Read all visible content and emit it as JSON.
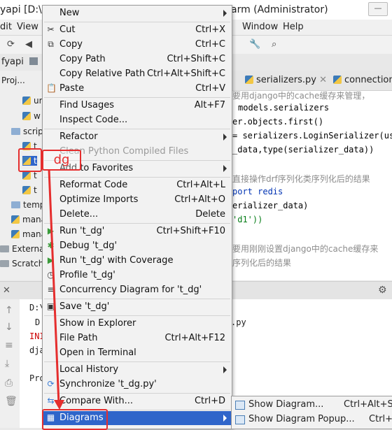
{
  "window": {
    "title_left": "yapi [D:\\Vir",
    "title_right": "arm (Administrator)",
    "controls": [
      "—",
      "□",
      "✕"
    ]
  },
  "menubar": {
    "left_items": [
      "dit",
      "View"
    ],
    "right_items": [
      "Window",
      "Help"
    ]
  },
  "navbar": {
    "project_name": "fyapi",
    "panel_label": "Proj..."
  },
  "project_tree": [
    {
      "label": "ur",
      "type": "py"
    },
    {
      "label": "w",
      "type": "py"
    },
    {
      "label": "scrip",
      "type": "folder"
    },
    {
      "label": "t",
      "type": "py"
    },
    {
      "label": "t",
      "type": "py"
    },
    {
      "label": "t",
      "type": "py"
    },
    {
      "label": "t",
      "type": "py"
    },
    {
      "label": "temp",
      "type": "folder"
    },
    {
      "label": "mana",
      "type": "py"
    },
    {
      "label": "mana",
      "type": "py"
    },
    {
      "label": "External",
      "type": "lib"
    },
    {
      "label": "Scratche",
      "type": "scratch"
    }
  ],
  "editor": {
    "tabs": [
      "serializers.py",
      "connection"
    ],
    "lines": [
      {
        "text": "要用django中的cache缓存来管理，",
        "kind": "comment"
      },
      {
        "text": "models.serializers",
        "kind": "code"
      },
      {
        "text": "er.objects.first()",
        "kind": "code"
      },
      {
        "text": "= serializers.LoginSerializer(use",
        "kind": "code"
      },
      {
        "text": "_data,type(serializer_data))",
        "kind": "code"
      },
      {
        "text": "直接操作drf序列化类序列化后的结果",
        "kind": "comment"
      },
      {
        "text": "port redis",
        "kind": "kw"
      },
      {
        "text": "erializer_data)",
        "kind": "code"
      },
      {
        "text": "'d1'))",
        "kind": "str"
      },
      {
        "text": "要用刚刚设置django中的cache缓存来",
        "kind": "comment"
      },
      {
        "text": "序列化后的结果",
        "kind": "comment"
      }
    ]
  },
  "run_output": {
    "lines": [
      "D:\\",
      "D",
      "INI",
      "dja",
      "Pro"
    ],
    "trailing": ".py"
  },
  "context_menu": {
    "items": [
      {
        "label": "New",
        "shortcut": "",
        "submenu": true,
        "icon": ""
      },
      {
        "sep": true
      },
      {
        "label": "Cut",
        "shortcut": "Ctrl+X",
        "icon": "scissors-icon"
      },
      {
        "label": "Copy",
        "shortcut": "Ctrl+C",
        "icon": "copy-icon"
      },
      {
        "label": "Copy Path",
        "shortcut": "Ctrl+Shift+C",
        "icon": ""
      },
      {
        "label": "Copy Relative Path",
        "shortcut": "Ctrl+Alt+Shift+C",
        "icon": ""
      },
      {
        "label": "Paste",
        "shortcut": "Ctrl+V",
        "icon": "paste-icon"
      },
      {
        "sep": true
      },
      {
        "label": "Find Usages",
        "shortcut": "Alt+F7",
        "icon": ""
      },
      {
        "label": "Inspect Code...",
        "shortcut": "",
        "icon": ""
      },
      {
        "sep": true
      },
      {
        "label": "Refactor",
        "shortcut": "",
        "submenu": true,
        "icon": ""
      },
      {
        "label": "Clean Python Compiled Files",
        "shortcut": "",
        "disabled": true,
        "icon": ""
      },
      {
        "sep": true
      },
      {
        "label": "Add to Favorites",
        "shortcut": "",
        "submenu": true,
        "icon": ""
      },
      {
        "sep": true
      },
      {
        "label": "Reformat Code",
        "shortcut": "Ctrl+Alt+L",
        "icon": ""
      },
      {
        "label": "Optimize Imports",
        "shortcut": "Ctrl+Alt+O",
        "icon": ""
      },
      {
        "label": "Delete...",
        "shortcut": "Delete",
        "icon": ""
      },
      {
        "sep": true
      },
      {
        "label": "Run 't_dg'",
        "shortcut": "Ctrl+Shift+F10",
        "icon": "run-icon"
      },
      {
        "label": "Debug 't_dg'",
        "shortcut": "",
        "icon": "debug-icon"
      },
      {
        "label": "Run 't_dg' with Coverage",
        "shortcut": "",
        "icon": "coverage-icon"
      },
      {
        "label": "Profile 't_dg'",
        "shortcut": "",
        "icon": "profile-icon"
      },
      {
        "label": "Concurrency Diagram for 't_dg'",
        "shortcut": "",
        "icon": "concurrency-icon"
      },
      {
        "sep": true
      },
      {
        "label": "Save 't_dg'",
        "shortcut": "",
        "icon": "save-icon"
      },
      {
        "sep": true
      },
      {
        "label": "Show in Explorer",
        "shortcut": "",
        "icon": ""
      },
      {
        "label": "File Path",
        "shortcut": "Ctrl+Alt+F12",
        "icon": ""
      },
      {
        "label": "Open in Terminal",
        "shortcut": "",
        "icon": ""
      },
      {
        "sep": true
      },
      {
        "label": "Local History",
        "shortcut": "",
        "submenu": true,
        "icon": ""
      },
      {
        "label": "Synchronize 't_dg.py'",
        "shortcut": "",
        "icon": "sync-icon"
      },
      {
        "sep": true
      },
      {
        "label": "Compare With...",
        "shortcut": "Ctrl+D",
        "icon": "compare-icon"
      },
      {
        "sep": true
      },
      {
        "label": "Diagrams",
        "shortcut": "",
        "submenu": true,
        "selected": true,
        "icon": "diagram-icon"
      }
    ]
  },
  "submenu": {
    "items": [
      {
        "label": "Show Diagram...",
        "shortcut": "Ctrl+Alt+Shi"
      },
      {
        "label": "Show Diagram Popup...",
        "shortcut": "Ctrl+A"
      }
    ]
  },
  "annotation": {
    "text": "dg",
    "color": "#e52e2e"
  },
  "colors": {
    "selection": "#2f65ca",
    "menu_bg": "#f2f2f2"
  }
}
